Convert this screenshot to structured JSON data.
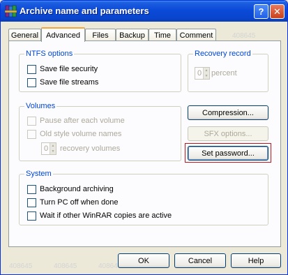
{
  "window": {
    "title": "Archive name and parameters",
    "help_glyph": "?",
    "close_glyph": "✕",
    "icon": "winrar-books-icon"
  },
  "tabs": [
    "General",
    "Advanced",
    "Files",
    "Backup",
    "Time",
    "Comment"
  ],
  "active_tab": "Advanced",
  "watermark": "408645",
  "ntfs": {
    "label": "NTFS options",
    "save_security": "Save file security",
    "save_streams": "Save file streams"
  },
  "recovery": {
    "label": "Recovery record",
    "value": "0",
    "unit": "percent"
  },
  "volumes": {
    "label": "Volumes",
    "pause": "Pause after each volume",
    "old_style": "Old style volume names",
    "recovery_value": "0",
    "recovery_label": "recovery volumes"
  },
  "buttons": {
    "compression": "Compression...",
    "sfx": "SFX options...",
    "password": "Set password..."
  },
  "system": {
    "label": "System",
    "background": "Background archiving",
    "turn_off": "Turn PC off when done",
    "wait": "Wait if other WinRAR copies are active"
  },
  "footer": {
    "ok": "OK",
    "cancel": "Cancel",
    "help": "Help"
  },
  "colors": {
    "titlebar": "#0a4ad8",
    "group_label": "#0046d5",
    "highlight": "#c0141e"
  }
}
